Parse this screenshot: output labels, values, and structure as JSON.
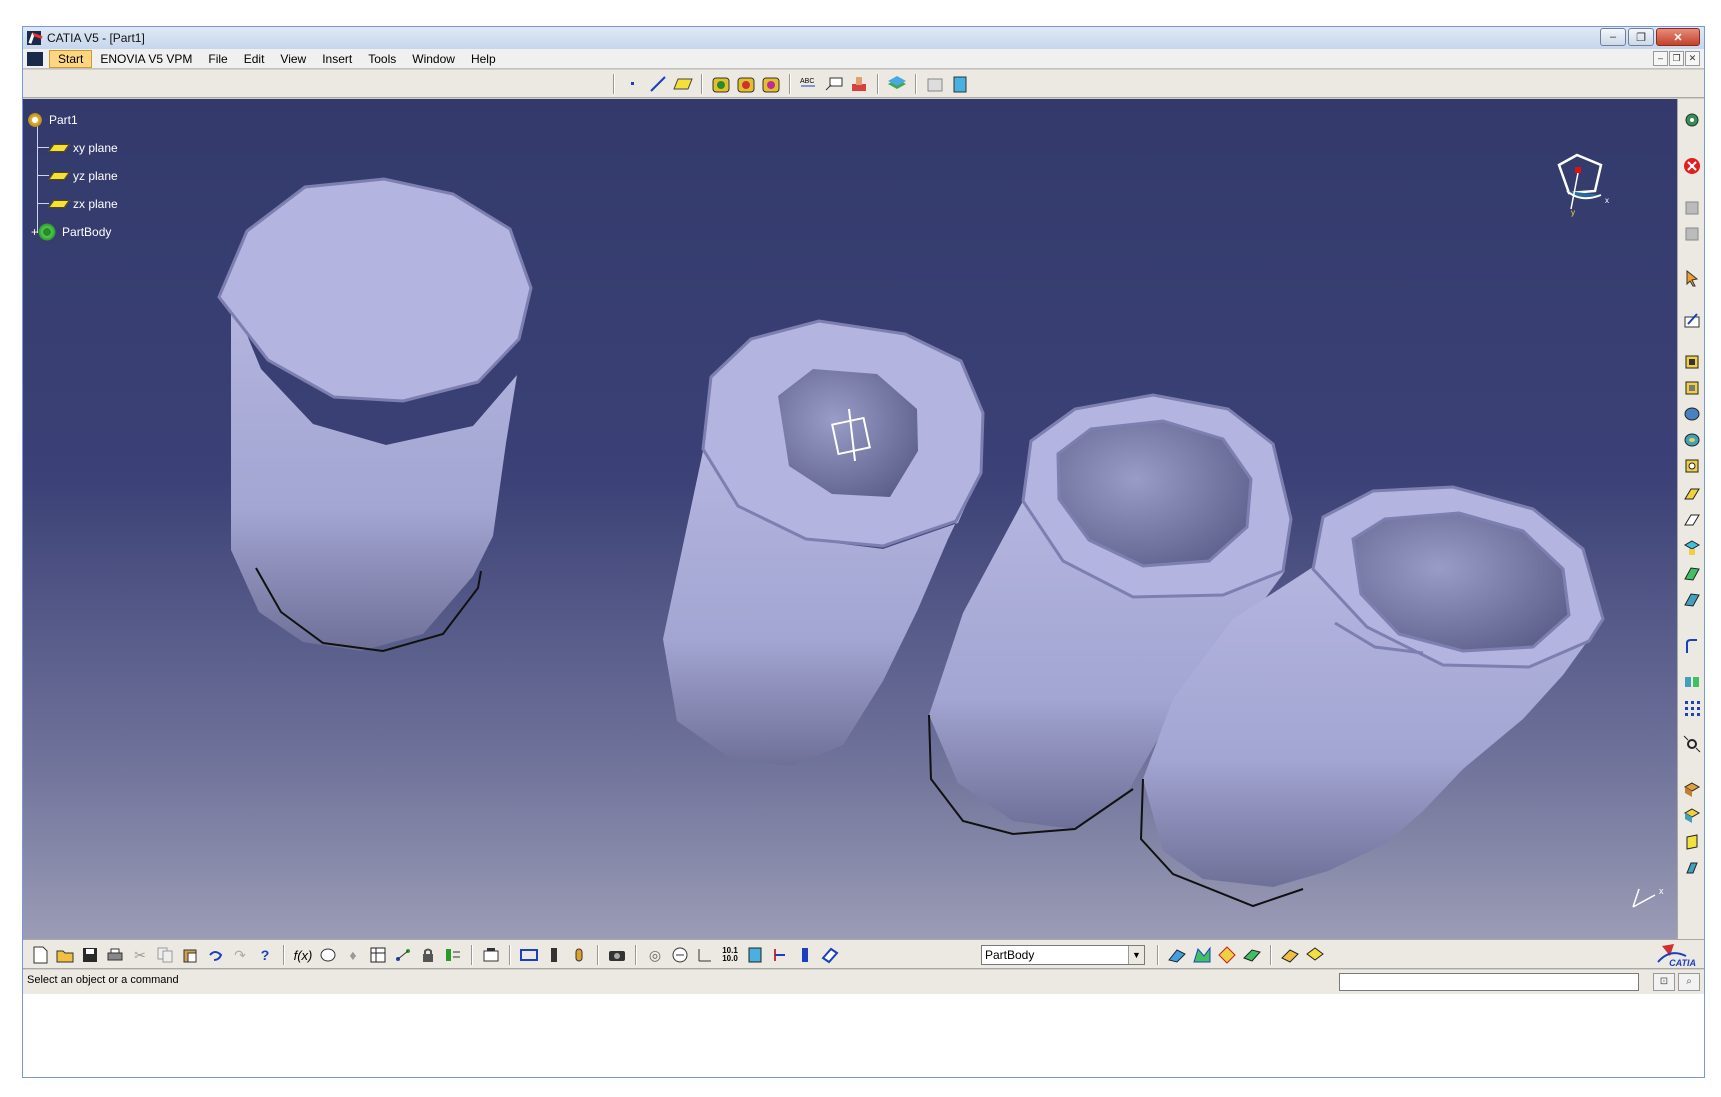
{
  "window": {
    "title": "CATIA V5 - [Part1]",
    "buttons": {
      "minimize": "–",
      "restore": "❐",
      "close": "✕"
    }
  },
  "menubar": {
    "items": [
      "Start",
      "ENOVIA V5 VPM",
      "File",
      "Edit",
      "View",
      "Insert",
      "Tools",
      "Window",
      "Help"
    ]
  },
  "tree": {
    "root": "Part1",
    "children": [
      "xy plane",
      "yz plane",
      "zx plane",
      "PartBody"
    ]
  },
  "compass": {
    "x_label": "x",
    "y_label": "y"
  },
  "bottom_toolbar": {
    "current_body": "PartBody",
    "brand": "CATIA"
  },
  "status": {
    "message": "Select an object or a command"
  },
  "colors": {
    "viewport_top": "#333a6b",
    "viewport_bottom": "#9b9cb6",
    "part_fill": "#b1b3dc",
    "part_shadow": "#7a7ca8"
  },
  "icons": {
    "top_toolbar": [
      "point-icon",
      "line-icon",
      "plane-icon",
      "pad-icon",
      "pocket-icon",
      "shaft-icon",
      "text-icon",
      "annotation-icon",
      "measure-icon",
      "layer-icon",
      "view-icon",
      "window-icon"
    ],
    "right_toolbar": [
      "settings-icon",
      "exit-icon",
      "hide-icon",
      "show-icon",
      "select-icon",
      "sketcher-icon",
      "pad-icon",
      "pocket-icon",
      "shaft-icon",
      "groove-icon",
      "hole-icon",
      "rib-icon",
      "slot-icon",
      "stiffener-icon",
      "loft-icon",
      "remove-loft-icon",
      "fillet-icon",
      "mirror-icon",
      "pattern-icon",
      "scale-icon",
      "boolean-icon",
      "add-icon",
      "assemble-icon",
      "intersect-icon"
    ]
  }
}
